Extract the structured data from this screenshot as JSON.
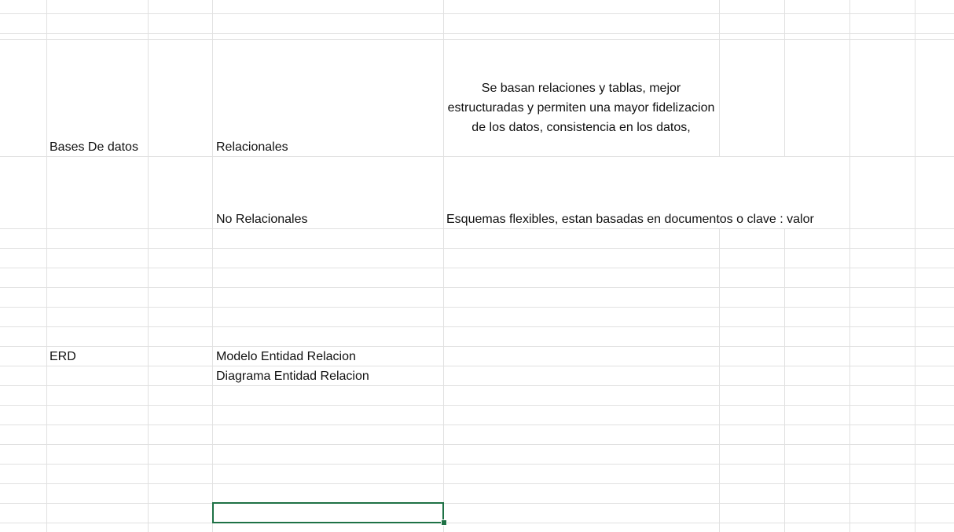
{
  "sheet": {
    "cells": {
      "bases_de_datos": "Bases De datos",
      "relacionales": "Relacionales",
      "relacionales_desc": "Se basan relaciones y tablas, mejor estructuradas y permiten una mayor fidelizacion de los datos, consistencia en los datos,",
      "no_relacionales": "No Relacionales",
      "no_relacionales_desc": "Esquemas flexibles, estan basadas en documentos o clave : valor",
      "erd": "ERD",
      "modelo_er": "Modelo Entidad Relacion",
      "diagrama_er": "Diagrama Entidad Relacion"
    },
    "selection_color": "#1e7145",
    "gridline_color": "#e1e1e1"
  }
}
